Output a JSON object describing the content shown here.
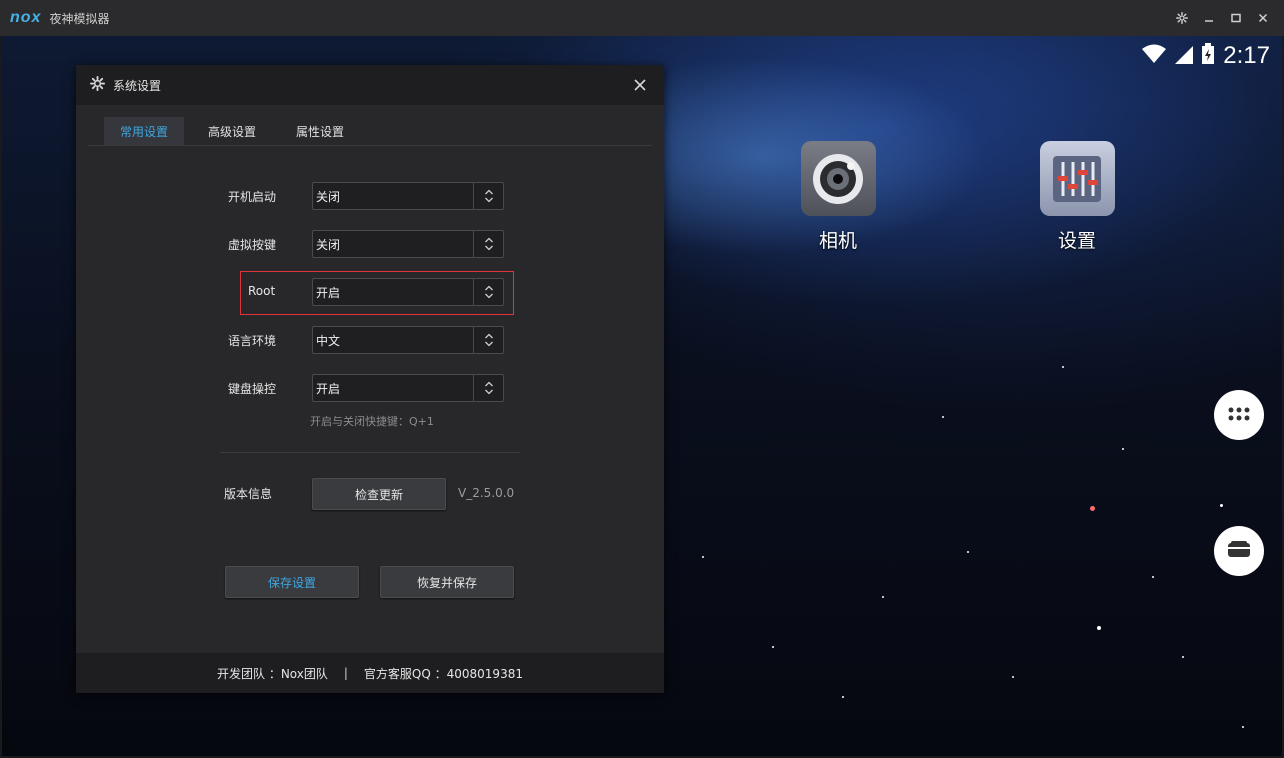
{
  "titlebar": {
    "logo_text": "nox",
    "title": "夜神模拟器",
    "controls": [
      "gear-icon",
      "minimize-icon",
      "maximize-icon",
      "close-icon"
    ]
  },
  "android": {
    "clock": "2:17",
    "status_icons": [
      "wifi-icon",
      "signal-icon",
      "battery-charging-icon"
    ],
    "apps": [
      {
        "label": "相机",
        "icon": "camera-icon"
      },
      {
        "label": "设置",
        "icon": "settings-sliders-icon"
      }
    ],
    "side_buttons": [
      "app-drawer-icon",
      "wallet-icon"
    ]
  },
  "dialog": {
    "title": "系统设置",
    "tabs": [
      {
        "label": "常用设置",
        "active": true
      },
      {
        "label": "高级设置",
        "active": false
      },
      {
        "label": "属性设置",
        "active": false
      }
    ],
    "settings": [
      {
        "label": "开机启动",
        "value": "关闭"
      },
      {
        "label": "虚拟按键",
        "value": "关闭"
      },
      {
        "label": "Root",
        "value": "开启",
        "highlighted": true
      },
      {
        "label": "语言环境",
        "value": "中文"
      },
      {
        "label": "键盘操控",
        "value": "开启"
      }
    ],
    "keyboard_hint": "开启与关闭快捷键：Q+1",
    "version_label": "版本信息",
    "check_update": "检查更新",
    "version": "V_2.5.0.0",
    "save": "保存设置",
    "restore_save": "恢复并保存",
    "footer": {
      "team": "开发团队 ：Nox团队",
      "divider": "|",
      "qq": "官方客服QQ ：4008019381"
    }
  },
  "colors": {
    "accent": "#3fa7e0",
    "highlight_border": "#e0343a",
    "dialog_bg": "#28282b",
    "titlebar_bg": "#2b2b2d"
  }
}
